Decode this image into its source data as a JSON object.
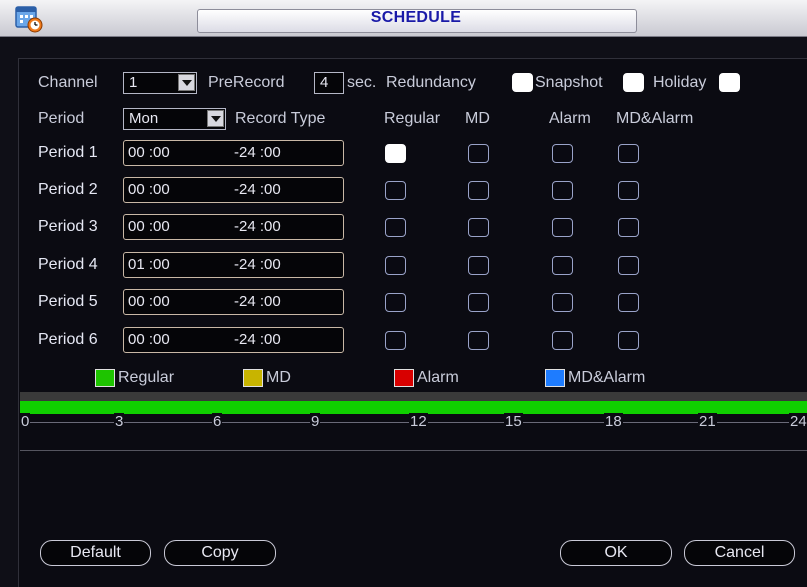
{
  "window": {
    "title": "SCHEDULE",
    "icon": "calendar-clock-icon"
  },
  "settings": {
    "channel_label": "Channel",
    "channel_value": "1",
    "prerecord_label": "PreRecord",
    "prerecord_value": "4",
    "prerecord_unit": "sec.",
    "redundancy_label": "Redundancy",
    "redundancy_checked": true,
    "snapshot_label": "Snapshot",
    "snapshot_checked": true,
    "holiday_label": "Holiday",
    "holiday_checked": true,
    "period_label": "Period",
    "period_value": "Mon",
    "record_type_label": "Record Type"
  },
  "columns": [
    "Regular",
    "MD",
    "Alarm",
    "MD&Alarm"
  ],
  "periods": [
    {
      "label": "Period 1",
      "start": "00 :00",
      "end": "-24 :00",
      "checks": [
        true,
        false,
        false,
        false
      ]
    },
    {
      "label": "Period 2",
      "start": "00 :00",
      "end": "-24 :00",
      "checks": [
        false,
        false,
        false,
        false
      ]
    },
    {
      "label": "Period 3",
      "start": "00 :00",
      "end": "-24 :00",
      "checks": [
        false,
        false,
        false,
        false
      ]
    },
    {
      "label": "Period 4",
      "start": "01 :00",
      "end": "-24 :00",
      "checks": [
        false,
        false,
        false,
        false
      ]
    },
    {
      "label": "Period 5",
      "start": "00 :00",
      "end": "-24 :00",
      "checks": [
        false,
        false,
        false,
        false
      ]
    },
    {
      "label": "Period 6",
      "start": "00 :00",
      "end": "-24 :00",
      "checks": [
        false,
        false,
        false,
        false
      ]
    }
  ],
  "legend": [
    {
      "label": "Regular",
      "color": "#1ec400"
    },
    {
      "label": "MD",
      "color": "#c8b400"
    },
    {
      "label": "Alarm",
      "color": "#d80000"
    },
    {
      "label": "MD&Alarm",
      "color": "#1e7cff"
    }
  ],
  "timeline": {
    "ticks": [
      "0",
      "3",
      "6",
      "9",
      "12",
      "15",
      "18",
      "21",
      "24"
    ],
    "bar_color": "#10d000"
  },
  "buttons": {
    "default": "Default",
    "copy": "Copy",
    "ok": "OK",
    "cancel": "Cancel"
  }
}
